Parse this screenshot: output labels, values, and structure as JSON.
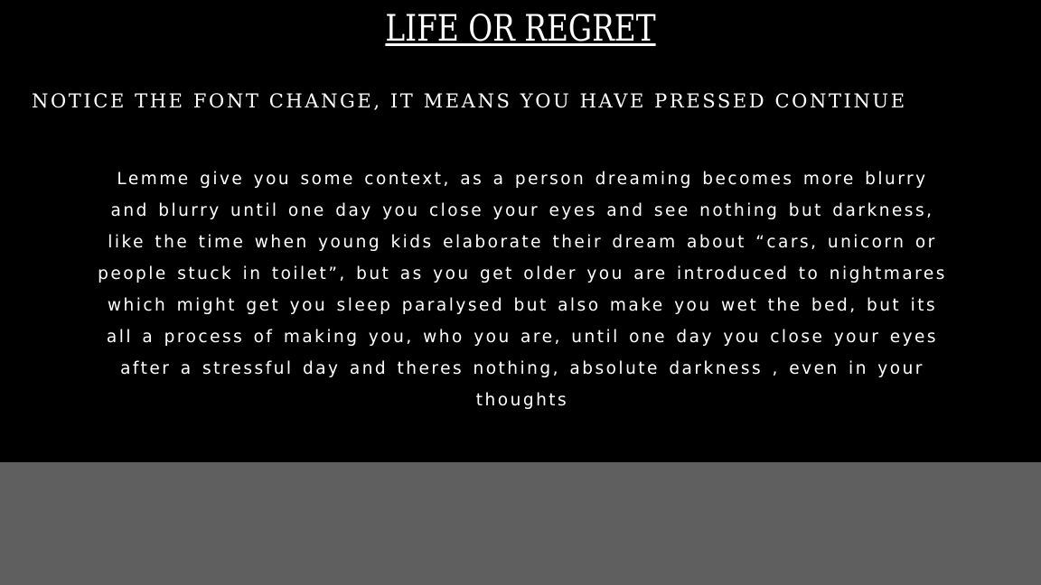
{
  "title": "LIFE OR REGRET",
  "notice": "NOTICE THE FONT CHANGE, IT MEANS YOU HAVE PRESSED CONTINUE",
  "story": "Lemme give you some context, as a person dreaming becomes more blurry and blurry until one day you close your eyes and see nothing but darkness, like the time when young kids elaborate their dream about “cars, unicorn or people stuck in toilet”, but as you get older you are introduced to nightmares which might get you sleep paralysed but also make you wet the bed, but its all a process of making you, who you are, until one day you close your eyes after a stressful day and theres nothing, absolute darkness , even in your thoughts",
  "colors": {
    "panel_background": "#000000",
    "text": "#ffffff",
    "bottom_background": "#5f5f5f"
  }
}
